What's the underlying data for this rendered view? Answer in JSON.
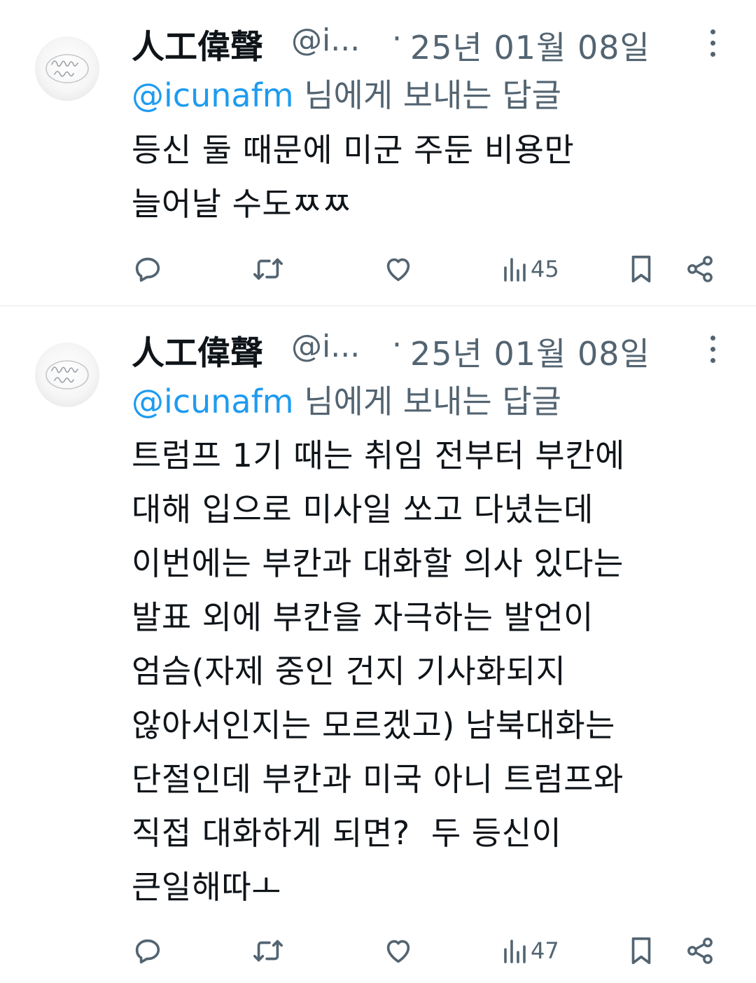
{
  "tweets": [
    {
      "author_name": "人工偉聲",
      "handle": "@i...",
      "separator": "·",
      "date": "25년 01월 08일",
      "reply_mention": "@icunafm",
      "reply_suffix": " 님에게 보내는 답글",
      "text": "등신 둘 때문에 미군 주둔 비용만\n늘어날 수도ㅉㅉ",
      "views": "45",
      "icons": [
        "reply-icon",
        "retweet-icon",
        "like-icon",
        "views-icon",
        "bookmark-icon",
        "share-icon",
        "more-icon"
      ]
    },
    {
      "author_name": "人工偉聲",
      "handle": "@i...",
      "separator": "·",
      "date": "25년 01월 08일",
      "reply_mention": "@icunafm",
      "reply_suffix": " 님에게 보내는 답글",
      "text": "트럼프 1기 때는 취임 전부터 부칸에\n대해 입으로 미사일 쏘고 다녔는데\n이번에는 부칸과 대화할 의사 있다는\n발표 외에 부칸을 자극하는 발언이\n엄슴(자제 중인 건지 기사화되지\n않아서인지는 모르겠고) 남북대화는\n단절인데 부칸과 미국 아니 트럼프와\n직접 대화하게 되면?  두 등신이\n큰일해따ㅗ",
      "views": "47",
      "icons": [
        "reply-icon",
        "retweet-icon",
        "like-icon",
        "views-icon",
        "bookmark-icon",
        "share-icon",
        "more-icon"
      ]
    }
  ],
  "colors": {
    "text": "#0f1419",
    "secondary": "#536471",
    "mention": "#1d9bf0",
    "divider": "#e6e9eb",
    "background": "#ffffff"
  }
}
